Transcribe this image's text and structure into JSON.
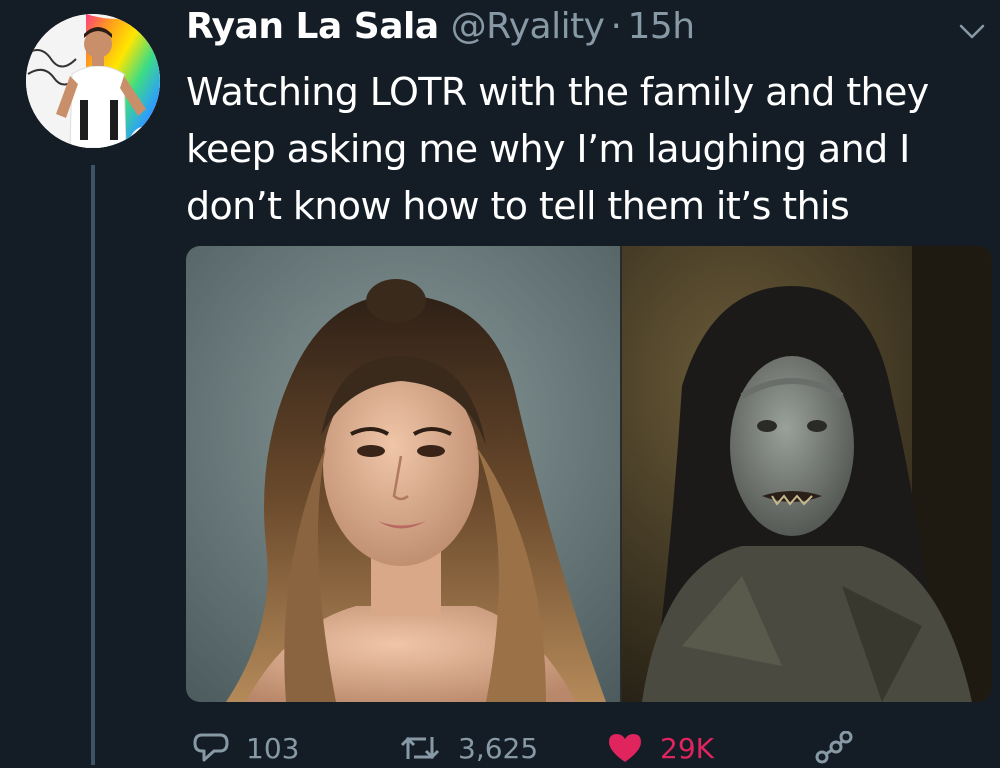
{
  "tweet": {
    "display_name": "Ryan La Sala",
    "handle": "@Ryality",
    "separator": "·",
    "time": "15h",
    "text_lines": [
      "Watching LOTR with the family and they",
      "keep asking me why I’m laughing and I",
      "don’t know how to tell them it’s this"
    ],
    "media": {
      "left_image": "portrait photo of a woman with long high ponytail",
      "right_image": "still of a grey-skinned orc with long dark hair"
    },
    "actions": {
      "reply_count": "103",
      "retweet_count": "3,625",
      "like_count": "29K"
    }
  },
  "icons": {
    "reply": "reply-icon",
    "retweet": "retweet-icon",
    "like": "heart-icon",
    "share": "share-icon",
    "more": "chevron-down-icon"
  },
  "colors": {
    "background": "#141d26",
    "secondary_text": "#8899a6",
    "like": "#e0245e",
    "thread_line": "#3d5466"
  }
}
